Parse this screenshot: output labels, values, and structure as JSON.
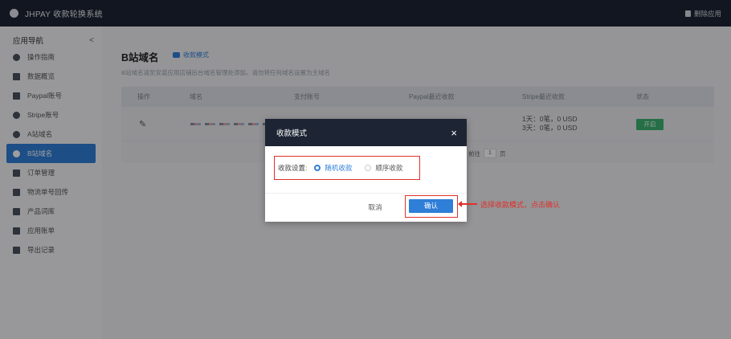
{
  "topbar": {
    "brand": "JHPAY 收款轮换系统",
    "right_action": "删除应用"
  },
  "sidebar": {
    "title": "应用导航",
    "collapse_icon": "<",
    "items": [
      {
        "label": "操作指南",
        "icon": "info-icon"
      },
      {
        "label": "数据概览",
        "icon": "chart-icon"
      },
      {
        "label": "Paypal账号",
        "icon": "paypal-icon"
      },
      {
        "label": "Stripe账号",
        "icon": "stripe-icon"
      },
      {
        "label": "A站域名",
        "icon": "a-site-icon"
      },
      {
        "label": "B站域名",
        "icon": "b-site-icon",
        "active": true
      },
      {
        "label": "订单管理",
        "icon": "order-icon"
      },
      {
        "label": "物流单号回传",
        "icon": "truck-icon"
      },
      {
        "label": "产品词库",
        "icon": "library-icon"
      },
      {
        "label": "应用账单",
        "icon": "bill-icon"
      },
      {
        "label": "导出记录",
        "icon": "download-icon"
      }
    ]
  },
  "main": {
    "title": "B站域名",
    "mode_link": "收款模式",
    "subtitle": "B站域名请至安装应用店铺后台域名管理处添加，请勿将任何域名设置为主域名",
    "columns": [
      "操作",
      "域名",
      "支付账号",
      "Paypal最近收款",
      "Stripe最近收款",
      "状态"
    ],
    "row": {
      "stripe_stat": [
        "1天：0笔，0 USD",
        "3天：0笔，0 USD"
      ],
      "status": "开启"
    },
    "pager": {
      "goto_label": "前往",
      "page": "1",
      "page_suffix": "页"
    }
  },
  "modal": {
    "title": "收款模式",
    "close": "×",
    "setting_label": "收款设置:",
    "options": [
      "随机收款",
      "顺序收款"
    ],
    "selected": "随机收款",
    "cancel": "取消",
    "confirm": "确认"
  },
  "annotation": {
    "text": "选择收款模式，点击确认"
  },
  "colors": {
    "accent": "#2f7ed8",
    "topbar": "#1d2534",
    "highlight": "#e0302a",
    "status_on": "#3cb371"
  }
}
